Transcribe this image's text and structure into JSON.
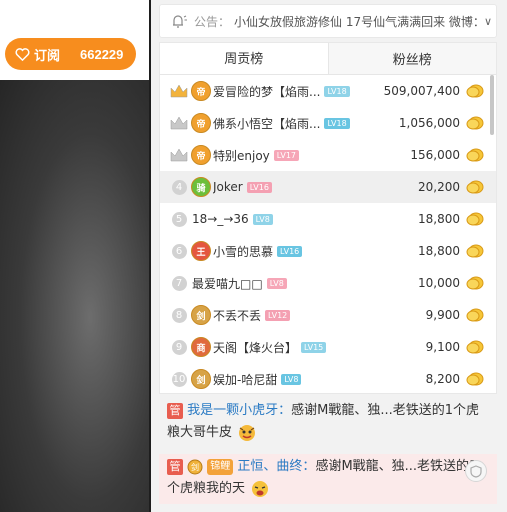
{
  "subscribe": {
    "label": "订阅",
    "count": "662229"
  },
  "notice": {
    "label": "公告：",
    "text": "小仙女放假旅游修仙 17号仙气满满回来 微博：",
    "chevron": "v"
  },
  "tabs": [
    {
      "label": "周贡榜"
    },
    {
      "label": "粉丝榜"
    }
  ],
  "ranking": [
    {
      "rank": "1",
      "badge": "帝",
      "name": "爱冒险的梦【焰雨...",
      "level": "LV18",
      "amount": "509,007,400"
    },
    {
      "rank": "2",
      "badge": "帝",
      "name": "佛系小悟空【焰雨...",
      "level": "LV18",
      "amount": "1,056,000"
    },
    {
      "rank": "3",
      "badge": "帝",
      "name": "特别enjoy",
      "level": "LV17",
      "amount": "156,000"
    },
    {
      "rank": "4",
      "badge": "骑",
      "name": "Joker",
      "level": "LV16",
      "amount": "20,200"
    },
    {
      "rank": "5",
      "badge": "",
      "name": "18→_→36",
      "level": "LV8",
      "amount": "18,800"
    },
    {
      "rank": "6",
      "badge": "王",
      "name": "小雪的思慕",
      "level": "LV16",
      "amount": "18,800"
    },
    {
      "rank": "7",
      "badge": "",
      "name": "最爱喵九□□",
      "level": "LV8",
      "amount": "10,000"
    },
    {
      "rank": "8",
      "badge": "剑",
      "name": "不丢不丢",
      "level": "LV12",
      "amount": "9,900"
    },
    {
      "rank": "9",
      "badge": "商",
      "name": "天阁【烽火台】",
      "level": "LV15",
      "amount": "9,100"
    },
    {
      "rank": "10",
      "badge": "剑",
      "name": "娱加-哈尼甜",
      "level": "LV8",
      "amount": "8,200"
    }
  ],
  "chat": [
    {
      "tag": "管",
      "user": "我是一颗小虎牙：",
      "text": "感谢M戰龍、独...老铁送的1个虎粮大哥牛皮"
    },
    {
      "tag": "管",
      "fan_badge": "锦鲤",
      "user": "正恒、曲终：",
      "text": "感谢M戰龍、独...老铁送的1个虎粮我的天"
    }
  ],
  "colors": {
    "accent": "#f78d1e",
    "crown_gold": "#f2b33d",
    "crown_silver": "#c8c8c8",
    "username_blue": "#2b7bc4",
    "admin_red": "#e85d4f"
  },
  "icons": {
    "notice": "bell-icon",
    "subscribe": "heart-icon",
    "coin": "coin-icon",
    "collapse": "chevron-down-icon",
    "shield": "shield-icon"
  }
}
